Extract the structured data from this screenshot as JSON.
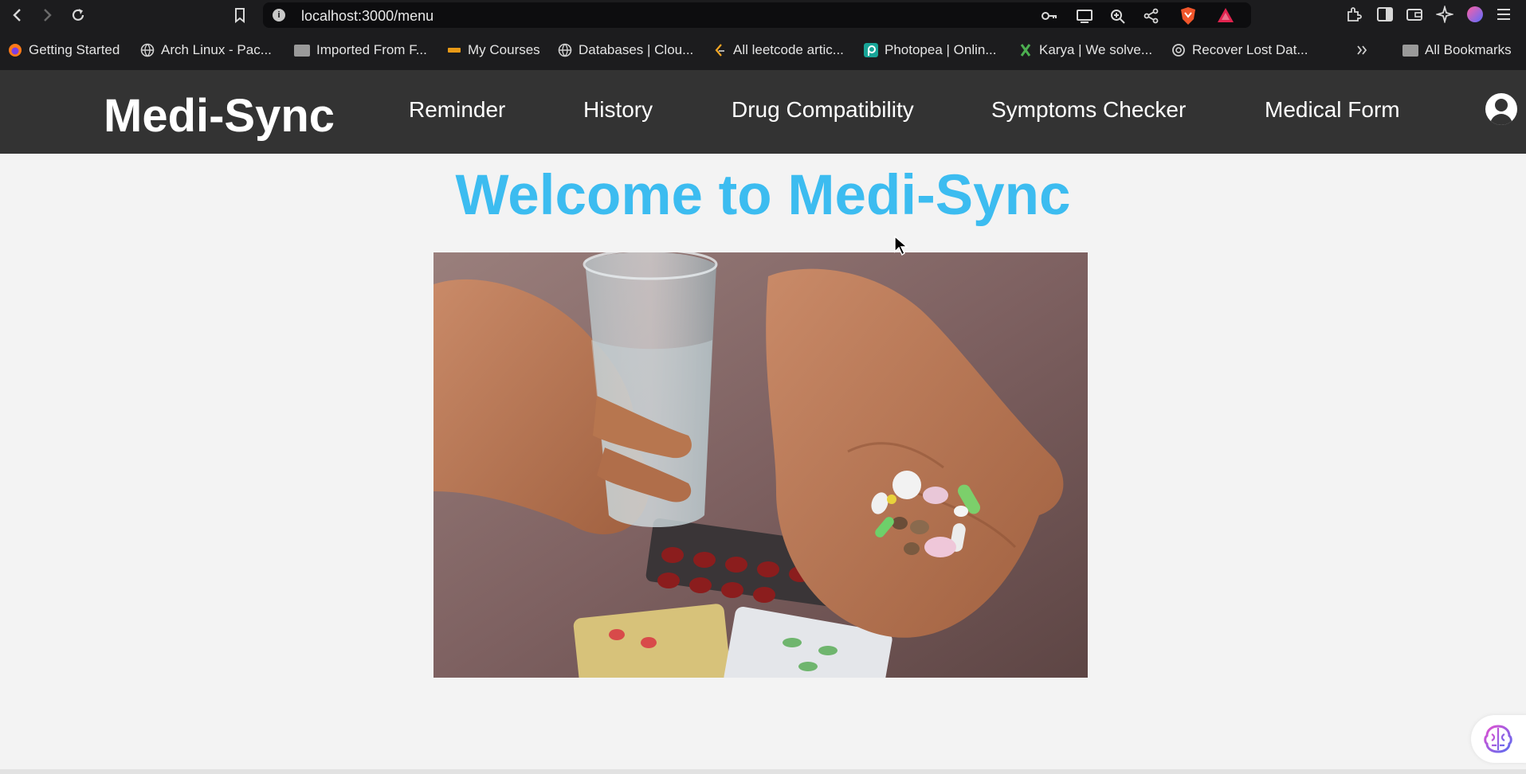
{
  "browser": {
    "url": "localhost:3000/menu",
    "bookmarks": [
      {
        "label": "Getting Started",
        "icon": "firefox-icon"
      },
      {
        "label": "Arch Linux - Pac...",
        "icon": "globe-icon"
      },
      {
        "label": "Imported From F...",
        "icon": "folder-icon"
      },
      {
        "label": "My Courses",
        "icon": "courses-icon"
      },
      {
        "label": "Databases | Clou...",
        "icon": "globe-icon"
      },
      {
        "label": "All leetcode artic...",
        "icon": "leetcode-icon"
      },
      {
        "label": "Photopea | Onlin...",
        "icon": "photopea-icon"
      },
      {
        "label": "Karya | We solve...",
        "icon": "karya-icon"
      },
      {
        "label": "Recover Lost Dat...",
        "icon": "openai-icon"
      }
    ],
    "all_bookmarks_label": "All Bookmarks"
  },
  "app": {
    "brand": "Medi-Sync",
    "nav": [
      "Reminder",
      "History",
      "Drug Compatibility",
      "Symptoms Checker",
      "Medical Form"
    ],
    "welcome": "Welcome to Medi-Sync"
  },
  "colors": {
    "header_bg": "#333333",
    "welcome_text": "#3cbcf0",
    "page_bg": "#f3f3f3",
    "browser_bg": "#1c1c1e"
  }
}
